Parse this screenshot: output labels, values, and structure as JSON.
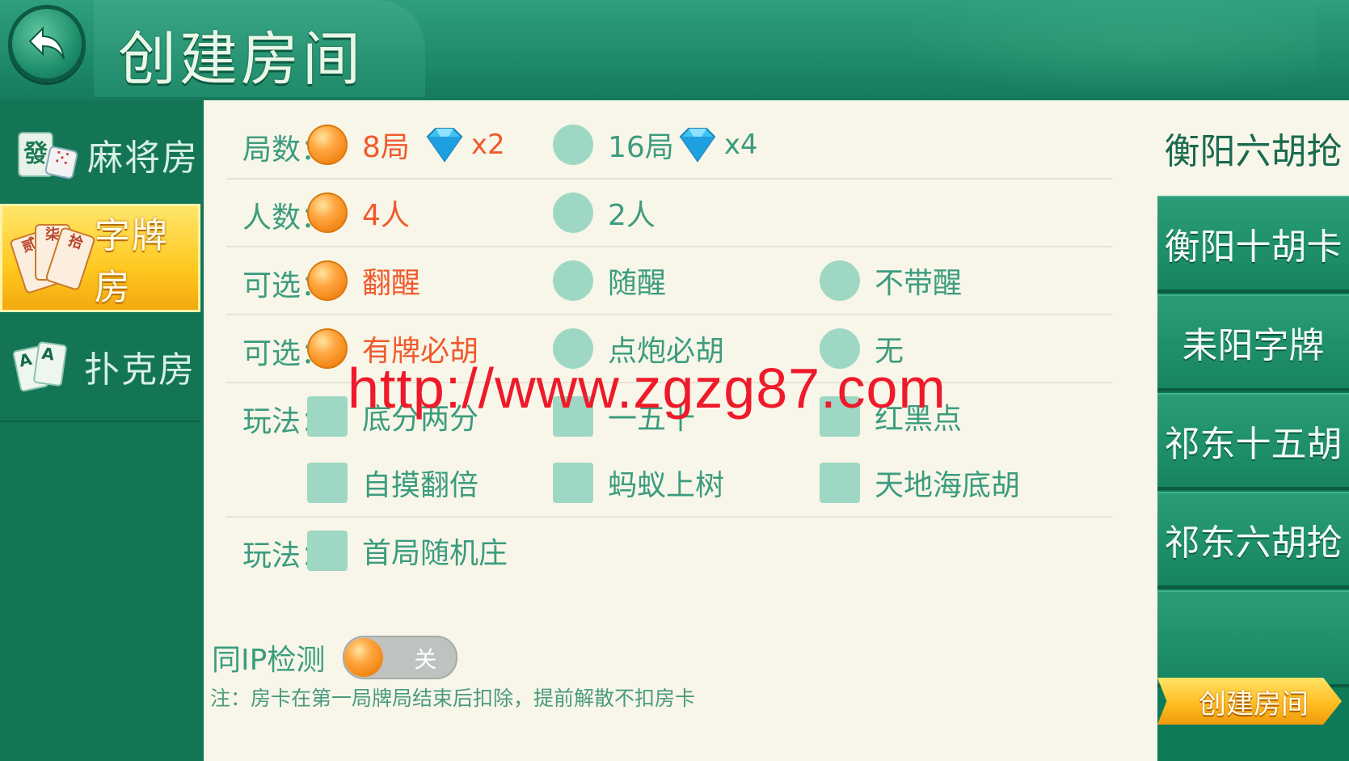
{
  "header": {
    "title": "创建房间"
  },
  "sidebar": {
    "items": [
      {
        "label": "麻将房",
        "active": false
      },
      {
        "label": "字牌房",
        "active": true
      },
      {
        "label": "扑克房",
        "active": false
      }
    ],
    "mahjong_tile_char": "發",
    "zipai_card_chars": [
      "贰",
      "柒",
      "拾"
    ],
    "poker_card_chars": [
      "A",
      "A"
    ]
  },
  "rules": {
    "rounds": {
      "label": "局数：",
      "options": [
        {
          "text": "8局",
          "multiplier": "x2",
          "selected": true
        },
        {
          "text": "16局",
          "multiplier": "x4",
          "selected": false
        }
      ]
    },
    "players": {
      "label": "人数：",
      "options": [
        {
          "text": "4人",
          "selected": true
        },
        {
          "text": "2人",
          "selected": false
        }
      ]
    },
    "optional1": {
      "label": "可选：",
      "options": [
        {
          "text": "翻醒",
          "selected": true
        },
        {
          "text": "随醒",
          "selected": false
        },
        {
          "text": "不带醒",
          "selected": false
        }
      ]
    },
    "optional2": {
      "label": "可选：",
      "options": [
        {
          "text": "有牌必胡",
          "selected": true
        },
        {
          "text": "点炮必胡",
          "selected": false
        },
        {
          "text": "无",
          "selected": false
        }
      ]
    },
    "play1": {
      "label": "玩法：",
      "options": [
        {
          "text": "底分两分",
          "checked": false
        },
        {
          "text": "一五十",
          "checked": false
        },
        {
          "text": "红黑点",
          "checked": false
        },
        {
          "text": "自摸翻倍",
          "checked": false
        },
        {
          "text": "蚂蚁上树",
          "checked": false
        },
        {
          "text": "天地海底胡",
          "checked": false
        }
      ]
    },
    "play2": {
      "label": "玩法：",
      "options": [
        {
          "text": "首局随机庄",
          "checked": false
        }
      ]
    }
  },
  "ip_check": {
    "label": "同IP检测",
    "state_text": "关",
    "on": false
  },
  "note": "注：房卡在第一局牌局结束后扣除，提前解散不扣房卡",
  "game_list": {
    "items": [
      {
        "label": "衡阳六胡抢",
        "active": true
      },
      {
        "label": "衡阳十胡卡",
        "active": false
      },
      {
        "label": "耒阳字牌",
        "active": false
      },
      {
        "label": "祁东十五胡",
        "active": false
      },
      {
        "label": "祁东六胡抢",
        "active": false
      }
    ]
  },
  "create_button": {
    "label": "创建房间"
  },
  "watermark": "http://www.zgzg87.com",
  "colors": {
    "accent_green": "#3b9c7e",
    "selected_text": "#f05a2c",
    "panel_bg": "#f8f6e9",
    "header_green": "#1f8a69"
  }
}
